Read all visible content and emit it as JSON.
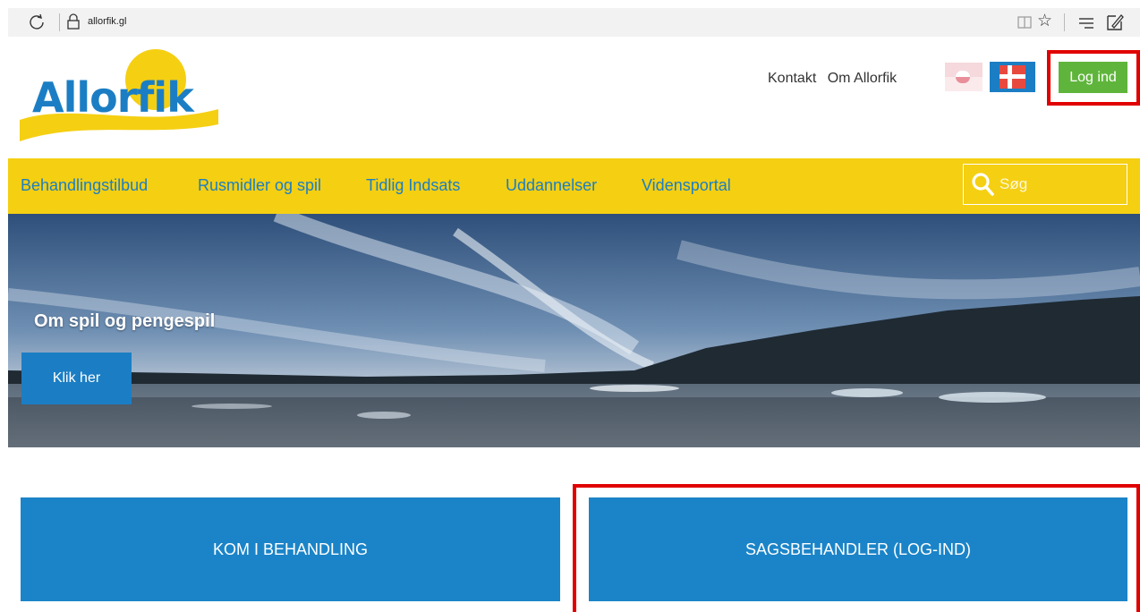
{
  "browser": {
    "url": "allorfik.gl"
  },
  "header": {
    "logo_text": "Allorfik",
    "links": [
      "Kontakt",
      "Om Allorfik"
    ],
    "login_label": "Log ind"
  },
  "nav": {
    "items": [
      "Behandlingstilbud",
      "Rusmidler og spil",
      "Tidlig Indsats",
      "Uddannelser",
      "Vidensportal"
    ],
    "search_placeholder": "Søg"
  },
  "hero": {
    "title": "Om spil og pengespil",
    "button_label": "Klik her"
  },
  "cta": {
    "left_label": "KOM I BEHANDLING",
    "right_label": "SAGSBEHANDLER (LOG-IND)"
  },
  "colors": {
    "brand_blue": "#1b7ec4",
    "nav_yellow": "#f5cf12",
    "login_green": "#5fb53b",
    "highlight_red": "#e00000"
  },
  "icons": [
    "refresh-icon",
    "lock-icon",
    "reader-view-icon",
    "favorite-star-icon",
    "hub-icon",
    "web-note-icon",
    "search-icon",
    "greenland-flag-icon",
    "denmark-flag-icon"
  ]
}
